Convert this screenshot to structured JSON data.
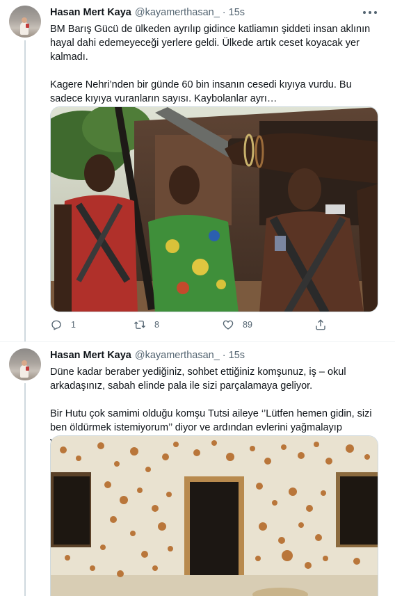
{
  "tweets": [
    {
      "author": {
        "name": "Hasan Mert Kaya",
        "handle": "@kayamerthasan_",
        "separator": "·",
        "time": "15s"
      },
      "paragraphs": [
        "BM Barış Gücü de ülkeden ayrılıp gidince katliamın şiddeti insan aklının hayal dahi edemeyeceği yerlere geldi. Ülkede artık ceset koyacak yer kalmadı.",
        "Kagere Nehri’nden bir günde 60 bin insanın cesedi kıyıya vurdu. Bu sadece kıyıya vuranların sayısı. Kaybolanlar ayrı…"
      ],
      "media_icon": "photo-armed-men-with-machete",
      "actions": {
        "replies": "1",
        "retweets": "8",
        "likes": "89"
      }
    },
    {
      "author": {
        "name": "Hasan Mert Kaya",
        "handle": "@kayamerthasan_",
        "separator": "·",
        "time": "15s"
      },
      "paragraphs": [
        "Düne kadar beraber yediğiniz, sohbet ettiğiniz komşunuz, iş – okul arkadaşınız, sabah elinde pala ile sizi parçalamaya geliyor.",
        "Bir Hutu çok samimi olduğu komşu Tutsi aileye ‘’Lütfen hemen gidin, sizi ben öldürmek istemiyorum’’ diyor ve ardından evlerini yağmalayıp yakıyor."
      ],
      "media_icon": "photo-bullet-riddled-wall"
    }
  ],
  "colors": {
    "text": "#0f1419",
    "secondary": "#536471",
    "divider": "#eff3f4",
    "thread_line": "#cfd9de"
  }
}
